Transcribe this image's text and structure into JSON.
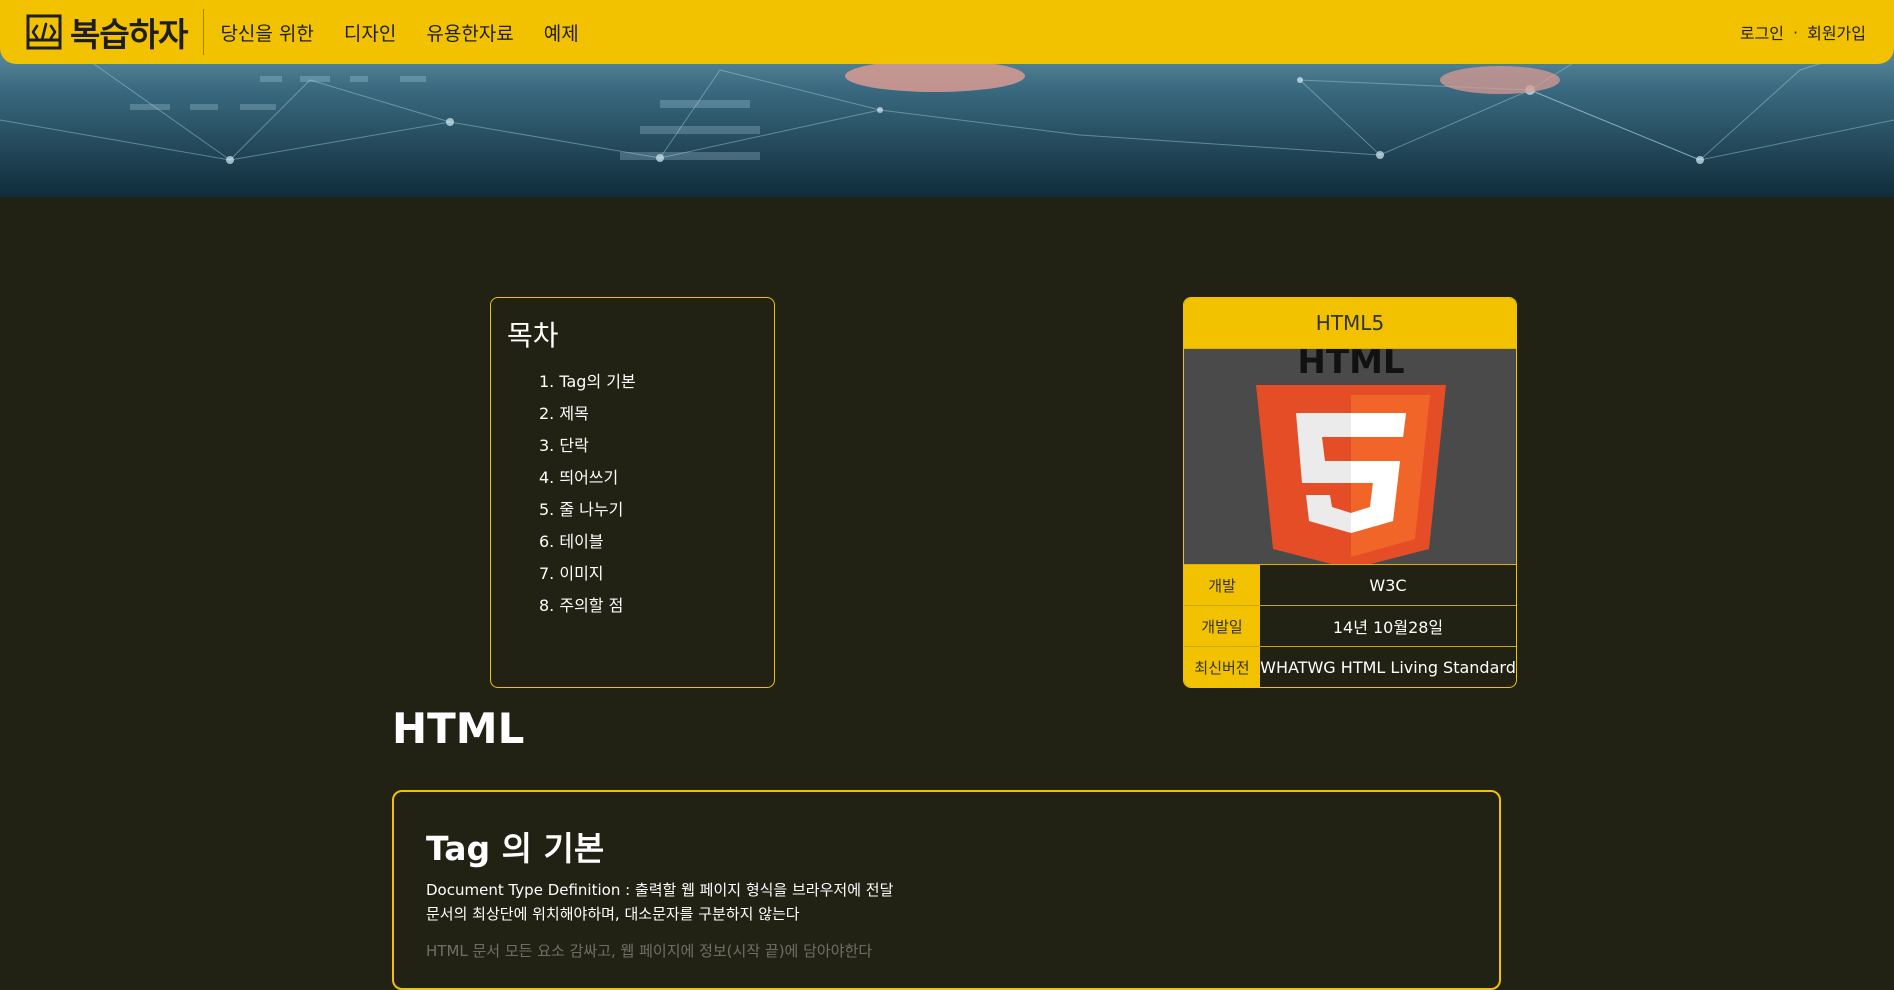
{
  "nav": {
    "logo_text": "복습하자",
    "links": [
      "당신을 위한",
      "디자인",
      "유용한자료",
      "예제"
    ],
    "login": "로그인",
    "separator": "·",
    "signup": "회원가입"
  },
  "toc": {
    "title": "목차",
    "items": [
      "1. Tag의 기본",
      "2. 제목",
      "3. 단락",
      "4. 띄어쓰기",
      "5. 줄 나누기",
      "6. 테이블",
      "7. 이미지",
      "8. 주의할 점"
    ]
  },
  "infobox": {
    "title": "HTML5",
    "logo_text": "HTML",
    "logo_number": "5",
    "rows": [
      {
        "key": "개발",
        "value": "W3C"
      },
      {
        "key": "개발일",
        "value": "14년 10월28일"
      },
      {
        "key": "최신버전",
        "value": "WHATWG HTML Living Standard"
      }
    ]
  },
  "main": {
    "heading": "HTML",
    "section": {
      "title": "Tag 의 기본",
      "line1": "Document Type Definition : 출력할 웹 페이지 형식을 브라우저에 전달",
      "line2": "문서의 최상단에 위치해야하며, 대소문자를 구분하지 않는다",
      "line3": "HTML 문서 모든 요소 감싸고, 웹 페이지에 정보(시작 끝)에 담아야한다"
    }
  },
  "colors": {
    "accent": "#f2c200",
    "background": "#212114",
    "html5_orange": "#e44d26",
    "html5_orange_light": "#f16529"
  },
  "icons": {
    "logo": "code-bracket-icon"
  }
}
